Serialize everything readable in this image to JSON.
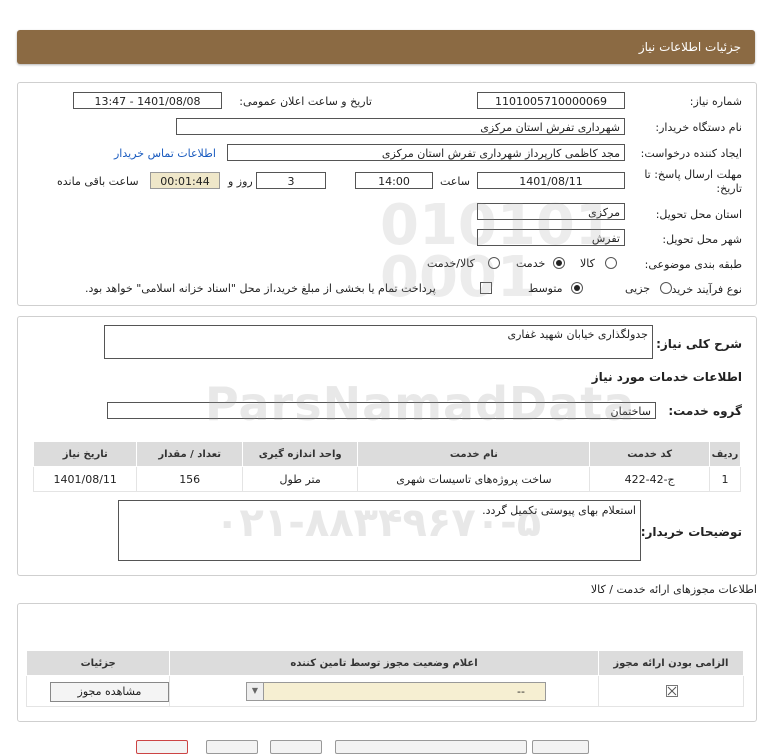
{
  "header": {
    "title": "جزئیات اطلاعات نیاز"
  },
  "need": {
    "number_label": "شماره نیاز:",
    "number": "1101005710000069",
    "announce_label": "تاریخ و ساعت اعلان عمومی:",
    "announce": "1401/08/08 - 13:47",
    "buyer_label": "نام دستگاه خریدار:",
    "buyer": "شهرداری تفرش استان مرکزی",
    "creator_label": "ایجاد کننده درخواست:",
    "creator": "مجد کاظمی کارپرداز شهرداری تفرش استان مرکزی",
    "contact_link": "اطلاعات تماس خریدار",
    "deadline_label": "مهلت ارسال پاسخ: تا",
    "deadline_label2": "تاریخ:",
    "deadline_date": "1401/08/11",
    "time_label": "ساعت",
    "deadline_time": "14:00",
    "days": "3",
    "days_label": "روز و",
    "remaining": "00:01:44",
    "remaining_label": "ساعت باقی مانده",
    "province_label": "استان محل تحویل:",
    "province": "مرکزی",
    "city_label": "شهر محل تحویل:",
    "city": "تفرش",
    "category_label": "طبقه بندی موضوعی:",
    "category_options": [
      "کالا",
      "خدمت",
      "کالا/خدمت"
    ],
    "category_selected": "خدمت",
    "process_label": "نوع فرآیند خرید :",
    "process_options": [
      "جزیی",
      "متوسط"
    ],
    "process_selected": "متوسط",
    "payment_note": "پرداخت تمام یا بخشی از مبلغ خرید،از محل \"اسناد خزانه اسلامی\" خواهد بود."
  },
  "summary": {
    "label": "شرح کلی نیاز:",
    "value": "جدولگذاری خیابان شهید غفاری",
    "services_title": "اطلاعات خدمات مورد نیاز",
    "group_label": "گروه خدمت:",
    "group_value": "ساختمان",
    "columns": [
      "ردیف",
      "کد خدمت",
      "نام خدمت",
      "واحد اندازه گیری",
      "تعداد / مقدار",
      "تاریخ نیاز"
    ],
    "rows": [
      [
        "1",
        "ج-42-422",
        "ساخت پروژه‌های تاسیسات شهری",
        "متر طول",
        "156",
        "1401/08/11"
      ]
    ],
    "buyer_notes_label": "توضیحات خریدار:",
    "buyer_notes": "استعلام بهای پیوستی تکمیل گردد."
  },
  "permits": {
    "title": "اطلاعات مجوزهای ارائه خدمت / کالا",
    "columns": [
      "الزامی بودن ارائه مجوز",
      "اعلام وضعیت مجوز توسط تامین کننده",
      "جزئیات"
    ],
    "status_value": "--",
    "view_button": "مشاهده مجوز"
  },
  "watermark": {
    "brand": "ParsNamadData",
    "phone": "۰۲۱-۸۸۳۴۹۶۷۰-۵"
  }
}
